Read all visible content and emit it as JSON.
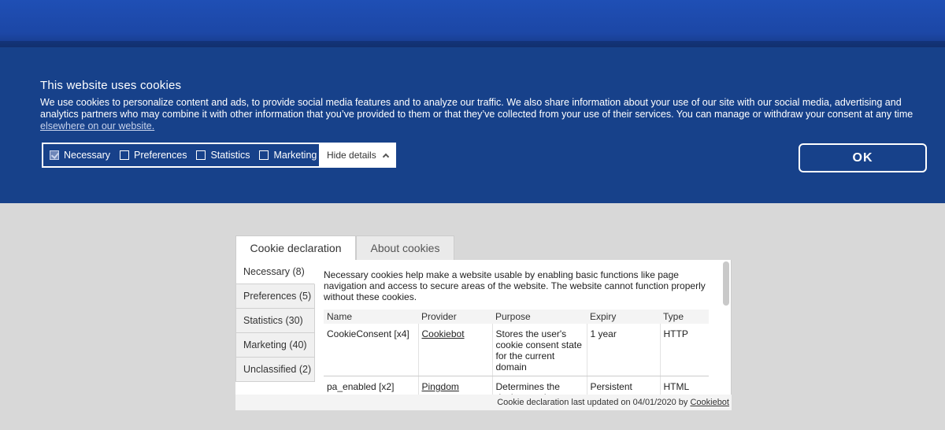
{
  "banner": {
    "title": "This website uses cookies",
    "text": "We use cookies to personalize content and ads, to provide social media features and to analyze our traffic. We also share information about your use of our site with our social media, advertising and analytics partners who may combine it with other information that you’ve provided to them or that they’ve collected from your use of their services. You can manage or withdraw your consent at any time",
    "link": "elsewhere on our website.",
    "checkboxes": [
      {
        "label": "Necessary",
        "checked": true
      },
      {
        "label": "Preferences",
        "checked": false
      },
      {
        "label": "Statistics",
        "checked": false
      },
      {
        "label": "Marketing",
        "checked": false
      }
    ],
    "hide_details": "Hide details",
    "ok": "OK"
  },
  "panel": {
    "tabs": [
      "Cookie declaration",
      "About cookies"
    ],
    "categories": [
      "Necessary (8)",
      "Preferences (5)",
      "Statistics (30)",
      "Marketing (40)",
      "Unclassified (2)"
    ],
    "description": "Necessary cookies help make a website usable by enabling basic functions like page navigation and access to secure areas of the website. The website cannot function properly without these cookies.",
    "columns": [
      "Name",
      "Provider",
      "Purpose",
      "Expiry",
      "Type"
    ],
    "rows": [
      {
        "name": "CookieConsent [x4]",
        "provider": "Cookiebot",
        "purpose": "Stores the user's cookie consent state for the current domain",
        "expiry": "1 year",
        "type": "HTTP"
      },
      {
        "name": "pa_enabled [x2]",
        "provider": "Pingdom",
        "purpose": "Determines the device used to",
        "expiry": "Persistent",
        "type": "HTML"
      }
    ],
    "footer_text": "Cookie declaration last updated on 04/01/2020 by",
    "footer_link": "Cookiebot"
  },
  "colors": {
    "banner_bg": "#17418a",
    "top_bg": "#1f4fb5",
    "page_bg": "#d8d8d8"
  }
}
